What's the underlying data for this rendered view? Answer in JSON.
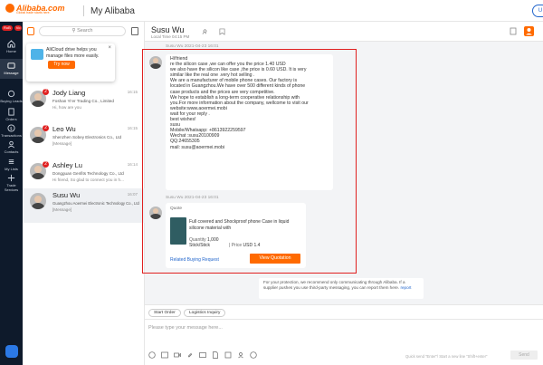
{
  "header": {
    "logo_text": "Alibaba.com",
    "logo_sub": "Global trade starts here.",
    "app_title": "My Alibaba",
    "user_button": "U"
  },
  "rail": {
    "badges": [
      "RoB",
      "Vo"
    ],
    "items": [
      {
        "label": "Home",
        "icon": "home-icon"
      },
      {
        "label": "Message",
        "icon": "message-icon"
      },
      {
        "label": "Buying Leads",
        "icon": "leads-icon"
      },
      {
        "label": "Orders",
        "icon": "orders-icon"
      },
      {
        "label": "Transactions",
        "icon": "transactions-icon"
      },
      {
        "label": "Contacts",
        "icon": "contacts-icon"
      },
      {
        "label": "My Lists",
        "icon": "lists-icon"
      },
      {
        "label": "Trade Services",
        "icon": "trade-services-icon"
      }
    ]
  },
  "list": {
    "search_placeholder": "Search",
    "promo": {
      "text": "AliCloud drive helps you manage files more easily.",
      "button": "Try now",
      "close": "×"
    },
    "conversations": [
      {
        "name": "Jody Liang",
        "time": "16:15",
        "company": "Foshan Yi’er Trading Co., Limited",
        "snippet": "Hi, how are you",
        "unread": "2"
      },
      {
        "name": "Leo Wu",
        "time": "16:15",
        "company": "Shenzhen Sobey Electronics Co., Ltd",
        "snippet": "[Message]",
        "unread": "2"
      },
      {
        "name": "Ashley Lu",
        "time": "16:14",
        "company": "Dongguan Genfits Technology Co., Ltd",
        "snippet": "Hi friend, So glad to connect you in h...",
        "unread": "2"
      },
      {
        "name": "Susu Wu",
        "time": "16:07",
        "company": "Guangzhou Aoermei Electronic Technology Co., Ltd",
        "snippet": "[Message]",
        "unread": ""
      }
    ]
  },
  "chat": {
    "name": "Susu Wu",
    "local_time": "Local Time 04:15 PM",
    "ts1": "Susu Wu   2021-04-23 16:01",
    "ts2": "Susu Wu   2021-04-23 16:01",
    "message_lines": [
      "Hi!friend",
      "re the silicon case ,we can offer you the price 1.40 USD",
      "we also have the silicon like case ,the price is 0.60 USD. It is very",
      "similar like the real one .very hot selling .",
      "We are a manufacturer of mobile phone cases. Our factory is",
      "located in Guangzhou.We have over 500 different kinds of phone",
      "case products and the prices are very competitive.",
      "We hope to establish a long-term cooperative relationship with",
      "you.For more information about the company, wellcome to visit our",
      "website:www.aoermei.mobi",
      "wait for your reply .",
      "best wishes!",
      "susu",
      "Mobile/Whatsapp: +8613922259597",
      "Wechat :susu20100909",
      "QQ:24655305",
      "mail: susu@aoermei.mobi"
    ],
    "quote": {
      "label": "Quote",
      "title": "Full covered and Shockproof phone Case in liquid silicone material with",
      "quantity_label": "Quantity",
      "quantity_value": "1,000",
      "unit": "Stick/Stick",
      "price_label": "Price",
      "price_value": "USD 1.4",
      "related_link": "Related Buying Request",
      "view_button": "View Quotation"
    },
    "notice": "For your protection, we recommend only communicating through Alibaba. If a supplier pushes you use third-party messaging, you can report them here.",
    "notice_link": "report"
  },
  "composer": {
    "chips": [
      "Start Order",
      "Logistics Inquiry"
    ],
    "placeholder": "Please type your message here...",
    "hint": "Quick send “Enter”/ Start a new line “Shift+enter”",
    "send": "Send"
  }
}
